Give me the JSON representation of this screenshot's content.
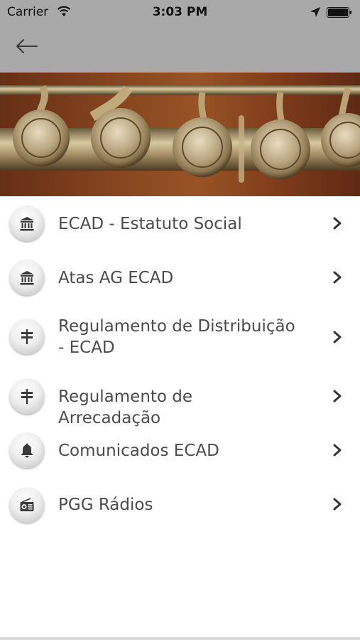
{
  "status_bar": {
    "carrier": "Carrier",
    "time": "3:03 PM"
  },
  "nav": {
    "back_icon": "back-arrow-icon"
  },
  "banner": {
    "image": "flute-keys-photo"
  },
  "menu": {
    "items": [
      {
        "label": "ECAD  - Estatuto Social",
        "icon": "bank-icon"
      },
      {
        "label": "Atas AG ECAD",
        "icon": "bank-icon"
      },
      {
        "label": "Regulamento de Distribuição - ECAD",
        "icon": "signpost-icon"
      },
      {
        "label": "Regulamento de Arrecadação",
        "icon": "signpost-icon"
      },
      {
        "label": "Comunicados ECAD",
        "icon": "bell-icon"
      },
      {
        "label": "PGG Rádios",
        "icon": "radio-icon"
      }
    ]
  },
  "colors": {
    "nav_bar": "#a9a9a9",
    "text": "#4b4b4b",
    "chevron": "#333333"
  }
}
